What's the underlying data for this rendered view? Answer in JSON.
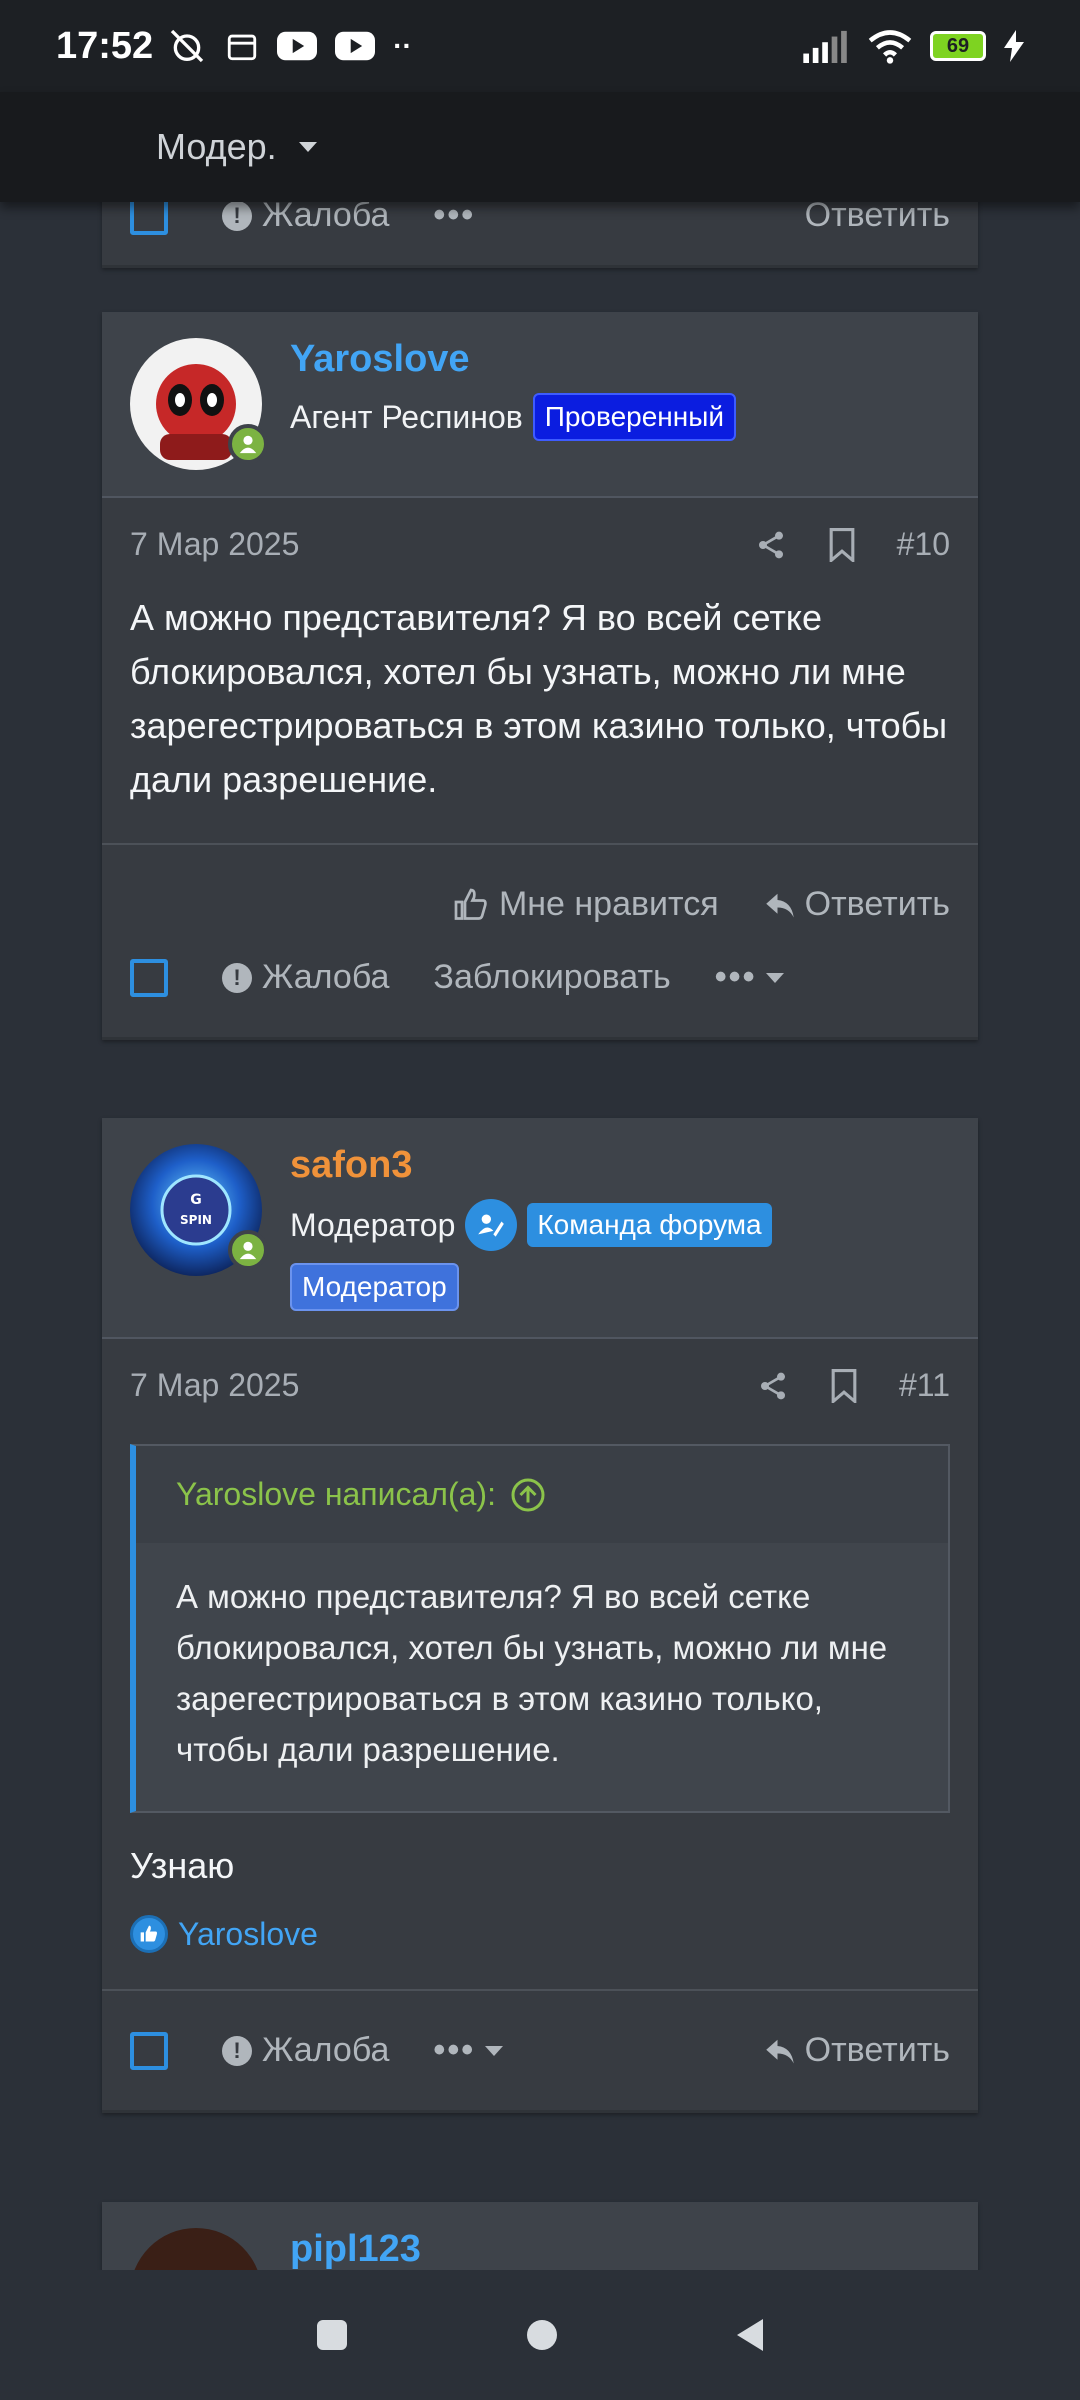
{
  "status": {
    "time": "17:52",
    "battery": "69"
  },
  "topbar": {
    "label": "Модер."
  },
  "prev_post": {
    "report_label": "Жалоба",
    "reply_label": "Ответить"
  },
  "posts": [
    {
      "username": "Yaroslove",
      "user_title": "Агент Респинов",
      "banners": [
        "Проверенный"
      ],
      "date": "7 Мар 2025",
      "number": "#10",
      "text": "А можно представителя? Я во всей сетке блокировался, хотел бы узнать, можно ли мне зарегестрироваться в этом казино только, чтобы дали разрешение.",
      "like_label": "Мне нравится",
      "reply_label": "Ответить",
      "report_label": "Жалоба",
      "block_label": "Заблокировать"
    },
    {
      "username": "safon3",
      "user_title": "Модератор",
      "banners": [
        "Команда форума",
        "Модератор"
      ],
      "date": "7 Мар 2025",
      "number": "#11",
      "quote_author": "Yaroslove написал(а):",
      "quote_text": "А можно представителя? Я во всей сетке блокировался, хотел бы узнать, можно ли мне зарегестрироваться в этом казино только, чтобы дали разрешение.",
      "text": "Узнаю",
      "liked_by": "Yaroslove",
      "report_label": "Жалоба",
      "reply_label": "Ответить"
    },
    {
      "username": "pipl123"
    }
  ],
  "colors": {
    "accent": "#2d8fe0",
    "online": "#7cb342",
    "quote_author": "#8bc34a",
    "moderator_name": "#f0923a"
  }
}
